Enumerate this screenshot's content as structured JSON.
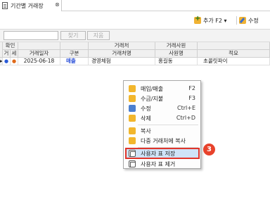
{
  "tab": {
    "label": "기간별 거래장",
    "close": "⊗"
  },
  "toolbar": {
    "add_label": "추가 F2 ▾",
    "edit_label": "수정"
  },
  "search": {
    "value": "",
    "placeholder": "",
    "find_label": "찾기",
    "clear_label": "지움"
  },
  "grid": {
    "group_headers": {
      "confirm": "확인",
      "partner": "거래처",
      "staff": "거래사원"
    },
    "col_headers": {
      "col_geo": "거",
      "col_se": "세",
      "date": "거래일자",
      "type": "구분",
      "partner_name": "거래처명",
      "staff_name": "사원명",
      "memo": "적요"
    },
    "rows": [
      {
        "date": "2025-06-18",
        "type": "매출",
        "partner": "경영체험",
        "staff": "홍길동",
        "memo": "초콜릿파이"
      }
    ]
  },
  "context_menu": {
    "items": [
      {
        "label": "매입/매출",
        "shortcut": "F2",
        "icon": "purchase-sale-icon"
      },
      {
        "label": "수금/지불",
        "shortcut": "F3",
        "icon": "collect-pay-icon"
      },
      {
        "label": "수정",
        "shortcut": "Ctrl+E",
        "icon": "edit-icon"
      },
      {
        "label": "삭제",
        "shortcut": "Ctrl+D",
        "icon": "delete-icon"
      },
      {
        "label": "복사",
        "shortcut": "",
        "icon": "copy-icon"
      },
      {
        "label": "다중 거래처에 복사",
        "shortcut": "",
        "icon": "multi-copy-icon"
      },
      {
        "label": "사용자 표 저장",
        "shortcut": "",
        "icon": "save-table-icon"
      },
      {
        "label": "사용자 표 제거",
        "shortcut": "",
        "icon": "remove-table-icon"
      }
    ]
  },
  "badge": {
    "label": "3"
  },
  "colors": {
    "highlight_border": "#e0352b",
    "badge": "#e8432c",
    "menu_highlight": "#cfe3f7",
    "maechul_text": "#2a4fd8"
  }
}
